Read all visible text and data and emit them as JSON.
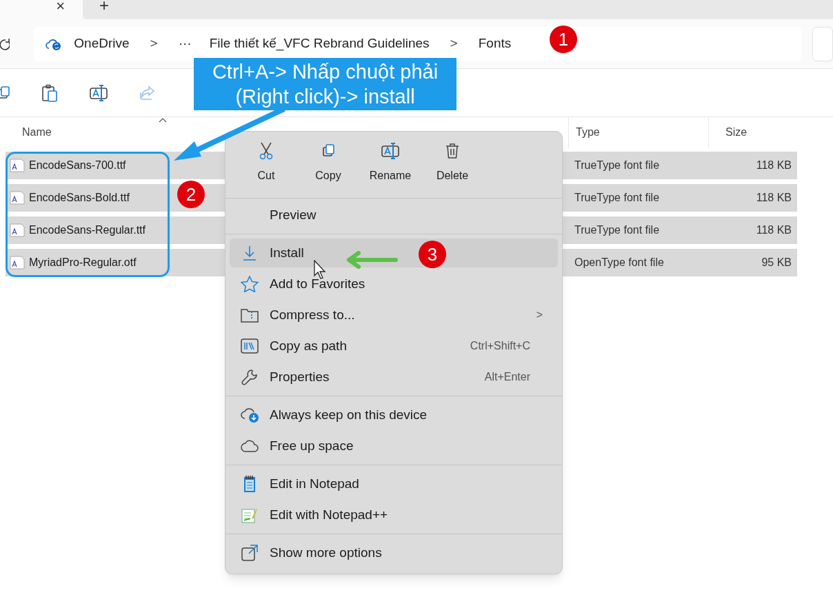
{
  "tabs": {
    "close": "×",
    "new": "+"
  },
  "address_bar": {
    "items": [
      {
        "kind": "crumb",
        "label": "OneDrive"
      },
      {
        "kind": "separator",
        "label": ">"
      },
      {
        "kind": "crumb",
        "label": "···"
      },
      {
        "kind": "crumb",
        "label": "File thiết kế_VFC Rebrand Guidelines"
      },
      {
        "kind": "separator",
        "label": ">"
      },
      {
        "kind": "crumb",
        "label": "Fonts"
      }
    ]
  },
  "columns": [
    {
      "label": "Name",
      "sorted": true
    },
    {
      "label": "Type",
      "sorted": false
    },
    {
      "label": "Size",
      "sorted": false
    }
  ],
  "files": [
    {
      "name": "EncodeSans-700.ttf",
      "type": "TrueType font file",
      "size": "118 KB",
      "selected": true
    },
    {
      "name": "EncodeSans-Bold.ttf",
      "type": "TrueType font file",
      "size": "118 KB",
      "selected": true
    },
    {
      "name": "EncodeSans-Regular.ttf",
      "type": "TrueType font file",
      "size": "118 KB",
      "selected": true
    },
    {
      "name": "MyriadPro-Regular.otf",
      "type": "OpenType font file",
      "size": "95 KB",
      "selected": true
    }
  ],
  "context_menu": {
    "quick_actions": [
      "Cut",
      "Copy",
      "Rename",
      "Delete"
    ],
    "items": [
      {
        "kind": "item",
        "label": "Preview",
        "selected": false
      },
      {
        "kind": "separator"
      },
      {
        "kind": "item",
        "label": "Install",
        "selected": true
      },
      {
        "kind": "item",
        "label": "Add to Favorites",
        "selected": false
      },
      {
        "kind": "item",
        "label": "Compress to...",
        "submenu": ">",
        "selected": false
      },
      {
        "kind": "item",
        "label": "Copy as path",
        "shortcut": "Ctrl+Shift+C",
        "selected": false
      },
      {
        "kind": "item",
        "label": "Properties",
        "shortcut": "Alt+Enter",
        "selected": false
      },
      {
        "kind": "separator"
      },
      {
        "kind": "item",
        "label": "Always keep on this device",
        "selected": false
      },
      {
        "kind": "item",
        "label": "Free up space",
        "selected": false
      },
      {
        "kind": "separator"
      },
      {
        "kind": "item",
        "label": "Edit in Notepad",
        "selected": false
      },
      {
        "kind": "item",
        "label": "Edit with Notepad++",
        "selected": false
      },
      {
        "kind": "separator"
      },
      {
        "kind": "item",
        "label": "Show more options",
        "selected": false
      }
    ]
  },
  "annotations": {
    "callout": "Ctrl+A-> Nhấp chuột phải (Right click)-> install",
    "steps": [
      "1",
      "2",
      "3"
    ]
  }
}
